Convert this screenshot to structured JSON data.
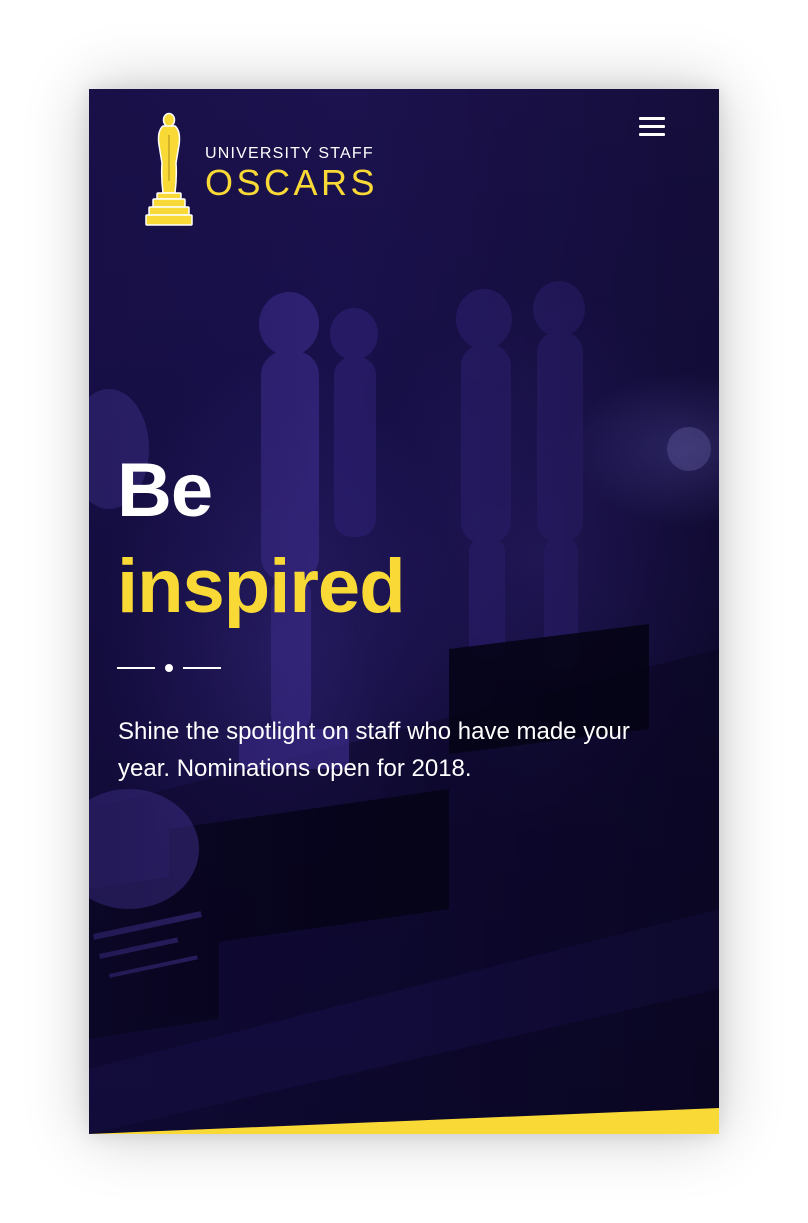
{
  "header": {
    "logo_small": "UNIVERSITY STAFF",
    "logo_large": "OSCARS",
    "menu_icon": "hamburger-menu-icon"
  },
  "hero": {
    "headline_line1": "Be",
    "headline_line2": "inspired",
    "tagline": "Shine the spotlight on staff who have made your year. Nominations open for 2018."
  },
  "colors": {
    "accent": "#f9d935",
    "background": "#140c3f",
    "text": "#ffffff"
  }
}
